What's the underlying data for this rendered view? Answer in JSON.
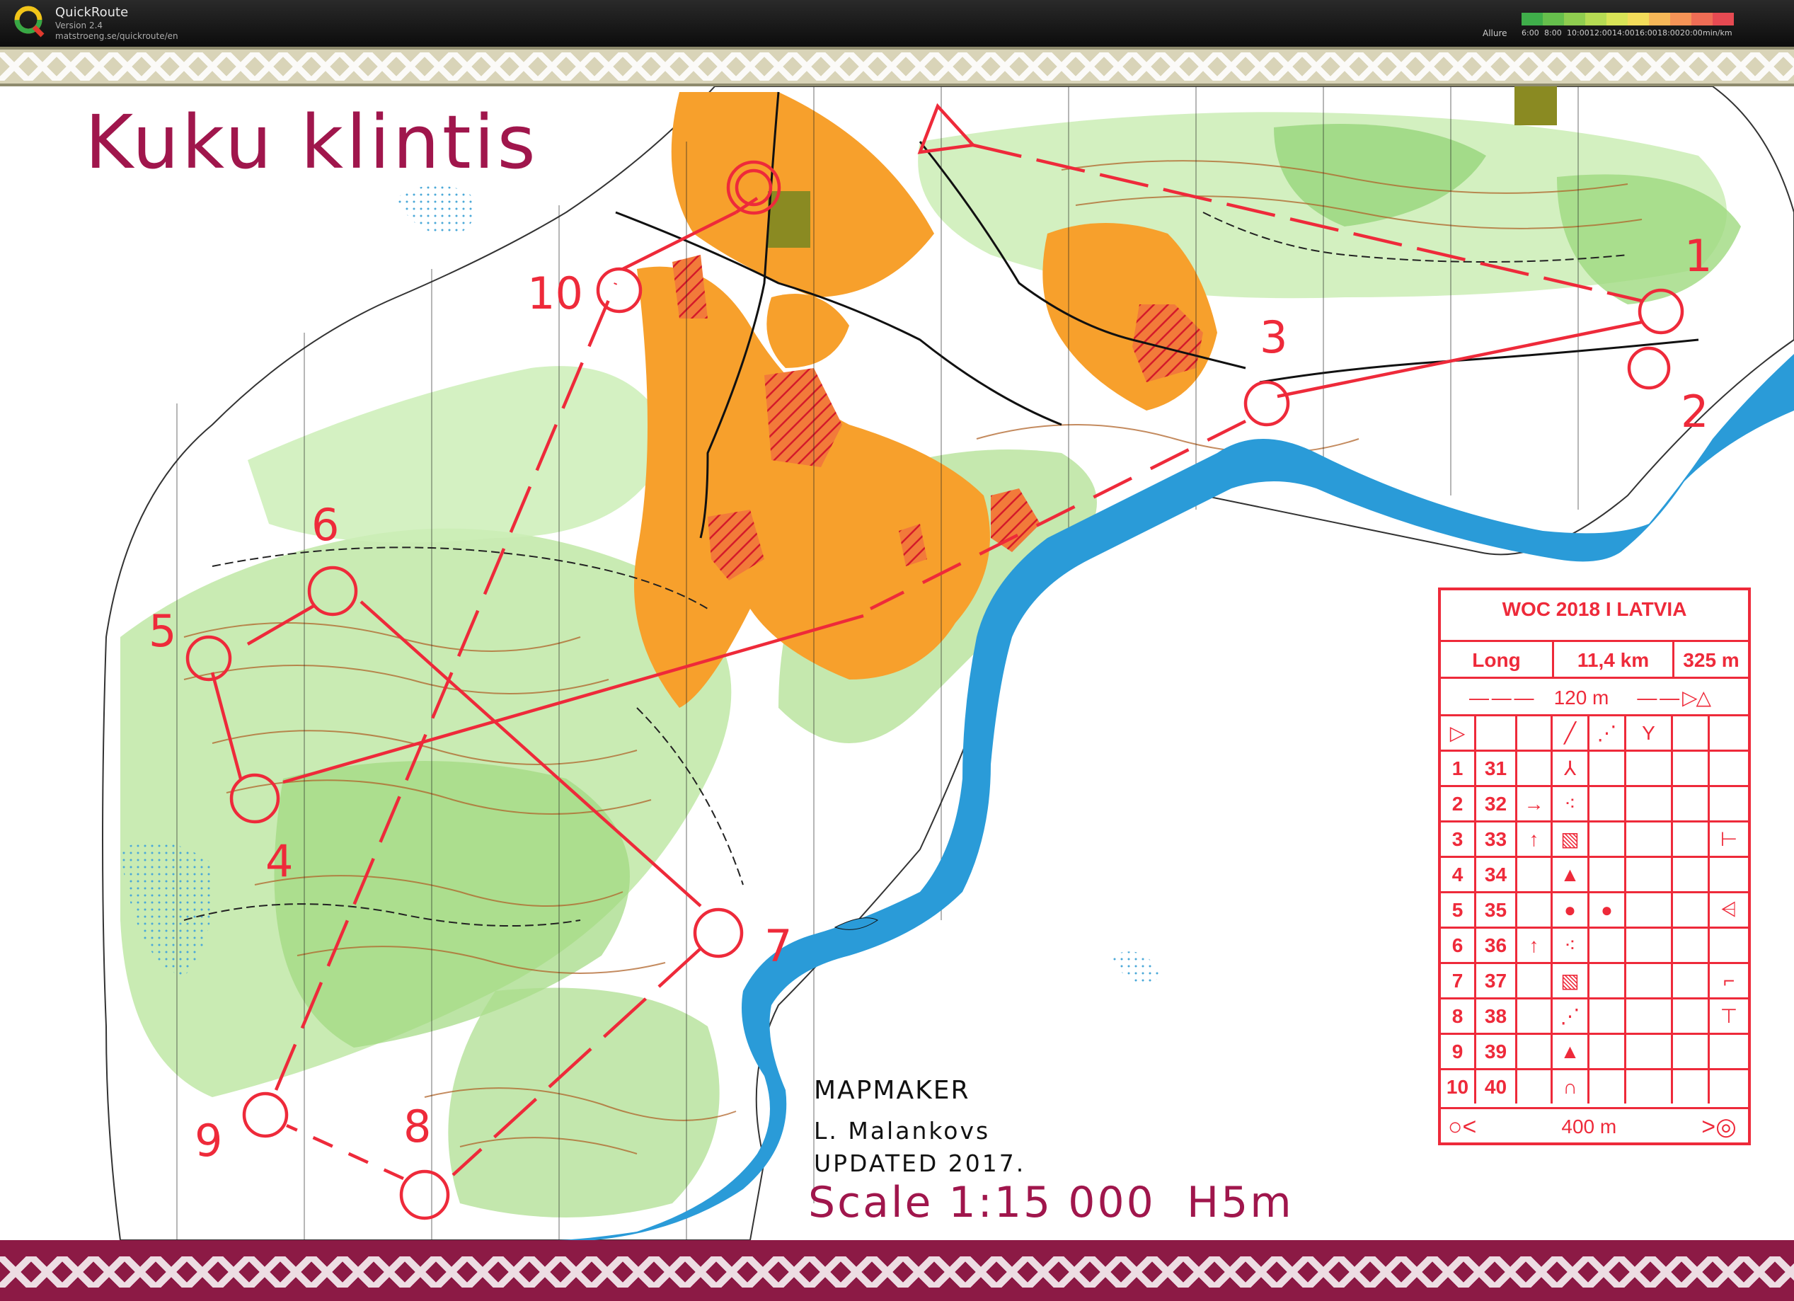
{
  "app": {
    "name": "QuickRoute",
    "version": "Version 2.4",
    "url": "matstroeng.se/quickroute/en",
    "pace_label": "Allure",
    "pace_ticks": [
      "6:00",
      "8:00",
      "10:00",
      "12:00",
      "14:00",
      "16:00",
      "18:00",
      "20:00",
      "min/km"
    ],
    "pace_colors": [
      "#3fae4a",
      "#66bf4c",
      "#8fcd4f",
      "#b6db53",
      "#d9e457",
      "#f3dc5a",
      "#f7b858",
      "#f59356",
      "#ef6d55",
      "#e64a52"
    ]
  },
  "map": {
    "title": "Kuku klintis",
    "mapmaker_label": "MAPMAKER",
    "mapmaker_name": "L. Malankovs",
    "updated": "UPDATED 2017.",
    "scale": "Scale 1:15 000  H5m",
    "control_numbers": [
      "1",
      "2",
      "3",
      "4",
      "5",
      "6",
      "7",
      "8",
      "9",
      "10"
    ],
    "colors": {
      "course": "#ee2a3a",
      "brand": "#a0164c",
      "forest": "#9fd97f",
      "open": "#f7a02c",
      "water": "#2a9bd8"
    }
  },
  "control_description": {
    "event": "WOC 2018 I LATVIA",
    "class": "Long",
    "length": "11,4 km",
    "climb": "325 m",
    "start_distance": "120 m",
    "finish_distance": "400 m",
    "rows": [
      {
        "num": "1",
        "code": "31",
        "dir": "",
        "feature": "⅄",
        "appearance": "",
        "position": ""
      },
      {
        "num": "2",
        "code": "32",
        "dir": "→",
        "feature": "⁖",
        "appearance": "",
        "position": ""
      },
      {
        "num": "3",
        "code": "33",
        "dir": "↑",
        "feature": "▧",
        "appearance": "",
        "position": "⊢"
      },
      {
        "num": "4",
        "code": "34",
        "dir": "",
        "feature": "▲",
        "appearance": "",
        "position": ""
      },
      {
        "num": "5",
        "code": "35",
        "dir": "",
        "feature": "●",
        "appearance": "●",
        "position": "⩤"
      },
      {
        "num": "6",
        "code": "36",
        "dir": "↑",
        "feature": "⁖",
        "appearance": "",
        "position": ""
      },
      {
        "num": "7",
        "code": "37",
        "dir": "",
        "feature": "▧",
        "appearance": "",
        "position": "⌐"
      },
      {
        "num": "8",
        "code": "38",
        "dir": "",
        "feature": "⋰",
        "appearance": "",
        "position": "⊤"
      },
      {
        "num": "9",
        "code": "39",
        "dir": "",
        "feature": "▲",
        "appearance": "",
        "position": ""
      },
      {
        "num": "10",
        "code": "40",
        "dir": "",
        "feature": "∩",
        "appearance": "",
        "position": ""
      }
    ]
  }
}
